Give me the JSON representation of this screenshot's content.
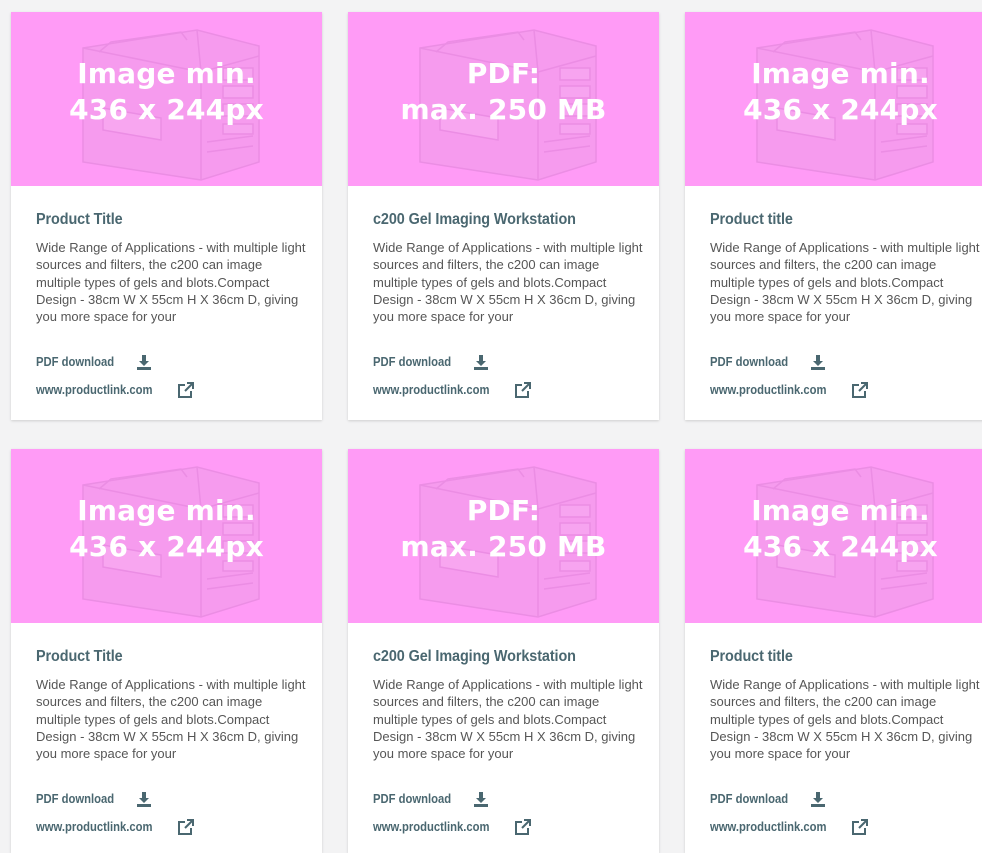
{
  "accent": "#4a6770",
  "media_color": "#ff9bf6",
  "cards": [
    {
      "overlay_line1": "Image min.",
      "overlay_line2": "436 x 244px",
      "title": "Product Title",
      "description": "Wide Range of Applications - with multiple light sources and filters, the c200 can image multiple types of gels and blots.Compact Design - 38cm W X 55cm H X 36cm D, giving you more space for your",
      "pdf_label": "PDF download",
      "pdf_icon": "download-icon",
      "link_label": "www.productlink.com",
      "link_icon": "external-link-icon"
    },
    {
      "overlay_line1": "PDF:",
      "overlay_line2": "max. 250 MB",
      "title": "c200 Gel Imaging Workstation",
      "description": "Wide Range of Applications - with multiple light sources and filters, the c200 can image multiple types of gels and blots.Compact Design - 38cm W X 55cm H X 36cm D, giving you more space for your",
      "pdf_label": "PDF download",
      "pdf_icon": "download-icon",
      "link_label": "www.productlink.com",
      "link_icon": "external-link-icon"
    },
    {
      "overlay_line1": "Image min.",
      "overlay_line2": "436 x 244px",
      "title": "Product title",
      "description": "Wide Range of Applications - with multiple light sources and filters, the c200 can image multiple types of gels and blots.Compact Design - 38cm W X 55cm H X 36cm D, giving you more space for your",
      "pdf_label": "PDF download",
      "pdf_icon": "download-icon",
      "link_label": "www.productlink.com",
      "link_icon": "external-link-icon"
    },
    {
      "overlay_line1": "Image min.",
      "overlay_line2": "436 x 244px",
      "title": "Product Title",
      "description": "Wide Range of Applications - with multiple light sources and filters, the c200 can image multiple types of gels and blots.Compact Design - 38cm W X 55cm H X 36cm D, giving you more space for your",
      "pdf_label": "PDF download",
      "pdf_icon": "download-icon",
      "link_label": "www.productlink.com",
      "link_icon": "external-link-icon"
    },
    {
      "overlay_line1": "PDF:",
      "overlay_line2": "max. 250 MB",
      "title": "c200 Gel Imaging Workstation",
      "description": "Wide Range of Applications - with multiple light sources and filters, the c200 can image multiple types of gels and blots.Compact Design - 38cm W X 55cm H X 36cm D, giving you more space for your",
      "pdf_label": "PDF download",
      "pdf_icon": "download-icon",
      "link_label": "www.productlink.com",
      "link_icon": "external-link-icon"
    },
    {
      "overlay_line1": "Image min.",
      "overlay_line2": "436 x 244px",
      "title": "Product title",
      "description": "Wide Range of Applications - with multiple light sources and filters, the c200 can image multiple types of gels and blots.Compact Design - 38cm W X 55cm H X 36cm D, giving you more space for your",
      "pdf_label": "PDF download",
      "pdf_icon": "download-icon",
      "link_label": "www.productlink.com",
      "link_icon": "external-link-icon"
    }
  ]
}
